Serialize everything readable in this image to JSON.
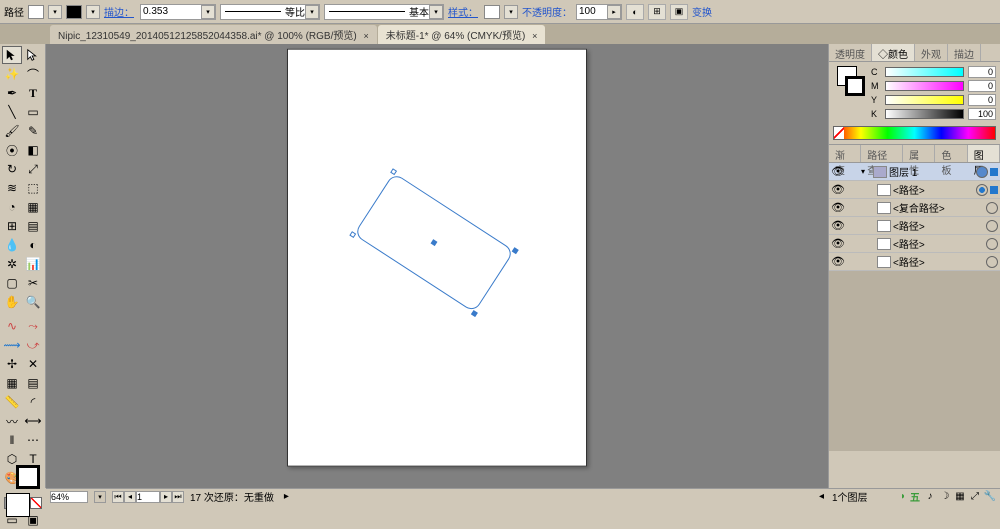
{
  "top": {
    "path_label": "路径",
    "stroke_label": "描边：",
    "stroke_weight": "0.353",
    "ratio_label": "等比",
    "basic_label": "基本",
    "style_label": "样式：",
    "opacity_label": "不透明度：",
    "opacity_value": "100",
    "transform_label": "变换"
  },
  "tabs": {
    "items": [
      {
        "label": "Nipic_12310549_20140512125852044358.ai* @ 100% (RGB/预览)",
        "active": false
      },
      {
        "label": "未标题-1* @ 64% (CMYK/预览)",
        "active": true
      }
    ]
  },
  "color": {
    "tab_transparency": "透明度",
    "tab_color": "◇颜色",
    "tab_appearance": "外观",
    "tab_stroke": "描边",
    "c": {
      "label": "C",
      "value": "0"
    },
    "m": {
      "label": "M",
      "value": "0"
    },
    "y": {
      "label": "Y",
      "value": "0"
    },
    "k": {
      "label": "K",
      "value": "100"
    }
  },
  "layers": {
    "tabs": {
      "gradient": "渐变",
      "pathfinder": "路径查",
      "attrs": "属性",
      "swatches": "色板",
      "layers": "图层"
    },
    "top_layer": "图层 1",
    "items": [
      {
        "name": "<路径>",
        "target_active": true
      },
      {
        "name": "<复合路径>",
        "target_active": false
      },
      {
        "name": "<路径>",
        "target_active": false
      },
      {
        "name": "<路径>",
        "target_active": false
      },
      {
        "name": "<路径>",
        "target_active": false
      }
    ],
    "footer": "1个图层"
  },
  "status": {
    "zoom": "64%",
    "page": "1",
    "undo_text": "17 次还原：无重做"
  },
  "ime": {
    "label": "五",
    "hint": "◗"
  }
}
